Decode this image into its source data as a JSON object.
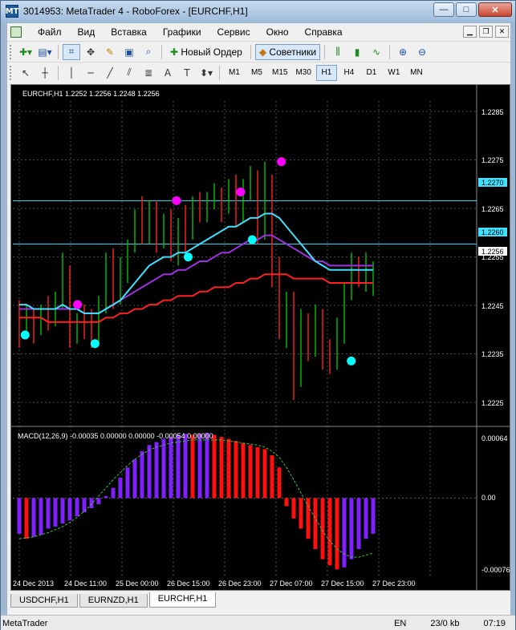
{
  "window": {
    "title": "3014953: MetaTrader 4 - RoboForex - [EURCHF,H1]",
    "app_icon": "MT",
    "buttons": {
      "minimize": "—",
      "maximize": "□",
      "close": "✕"
    }
  },
  "menu": {
    "items": [
      "Файл",
      "Вид",
      "Вставка",
      "Графики",
      "Сервис",
      "Окно",
      "Справка"
    ]
  },
  "toolbar1": {
    "new_order": "Новый Ордер",
    "advisors": "Советники"
  },
  "toolbar2": {
    "timeframes": [
      "M1",
      "M5",
      "M15",
      "M30",
      "H1",
      "H4",
      "D1",
      "W1",
      "MN"
    ],
    "active_timeframe": "H1"
  },
  "chart": {
    "header": "EURCHF,H1  1.2252 1.2256 1.2248 1.2256",
    "price_labels": [
      "1.2285",
      "1.2275",
      "1.2265",
      "1.2255",
      "1.2245",
      "1.2235",
      "1.2225"
    ],
    "hline_labels": [
      "1.2270",
      "1.2260"
    ],
    "current_price": "1.2256",
    "macd_header": "MACD(12,26,9) -0.00035 0.00000 0.00000 -0.00054 0.00000",
    "macd_labels": [
      "0.00064",
      "0.00",
      "-0.00076"
    ],
    "time_labels": [
      "24 Dec 2013",
      "24 Dec 11:00",
      "25 Dec 00:00",
      "26 Dec 15:00",
      "26 Dec 23:00",
      "27 Dec 07:00",
      "27 Dec 15:00",
      "27 Dec 23:00"
    ],
    "colors": {
      "bull": "#00c000",
      "bear": "#ff2020",
      "ma_cyan": "#40e0ff",
      "ma_purple": "#a030e0",
      "ma_red": "#ff2020",
      "macd_pos": "#8020ff",
      "macd_neg": "#ff1010",
      "signal": "#40c040",
      "dot_magenta": "#ff00ff",
      "dot_cyan": "#00ffff"
    }
  },
  "chart_data": {
    "type": "candlestick",
    "price_range": [
      1.2219,
      1.2293
    ],
    "candles": [
      [
        1.2244,
        1.2247,
        1.2236,
        1.2241
      ],
      [
        1.2241,
        1.2246,
        1.2238,
        1.2243
      ],
      [
        1.2243,
        1.2245,
        1.2237,
        1.224
      ],
      [
        1.224,
        1.2246,
        1.2239,
        1.2245
      ],
      [
        1.2245,
        1.2248,
        1.224,
        1.2242
      ],
      [
        1.2242,
        1.2249,
        1.2241,
        1.2248
      ],
      [
        1.2248,
        1.2258,
        1.2245,
        1.2253
      ],
      [
        1.2253,
        1.2255,
        1.2236,
        1.224
      ],
      [
        1.224,
        1.2244,
        1.2237,
        1.2243
      ],
      [
        1.2243,
        1.2246,
        1.2238,
        1.2241
      ],
      [
        1.2241,
        1.2245,
        1.2236,
        1.2238
      ],
      [
        1.2238,
        1.2248,
        1.2237,
        1.2246
      ],
      [
        1.2246,
        1.2258,
        1.2244,
        1.2256
      ],
      [
        1.2256,
        1.2259,
        1.2245,
        1.2248
      ],
      [
        1.2248,
        1.2257,
        1.2246,
        1.2255
      ],
      [
        1.2255,
        1.2261,
        1.2251,
        1.2259
      ],
      [
        1.2259,
        1.2268,
        1.2258,
        1.2266
      ],
      [
        1.2266,
        1.2271,
        1.226,
        1.2262
      ],
      [
        1.2262,
        1.227,
        1.226,
        1.2268
      ],
      [
        1.2268,
        1.227,
        1.2258,
        1.226
      ],
      [
        1.226,
        1.2267,
        1.2259,
        1.2265
      ],
      [
        1.2265,
        1.2268,
        1.2256,
        1.2258
      ],
      [
        1.2258,
        1.2266,
        1.2255,
        1.2264
      ],
      [
        1.2264,
        1.2269,
        1.2258,
        1.2262
      ],
      [
        1.2262,
        1.2271,
        1.2261,
        1.227
      ],
      [
        1.227,
        1.2272,
        1.2265,
        1.2268
      ],
      [
        1.2268,
        1.2272,
        1.2265,
        1.227
      ],
      [
        1.227,
        1.2274,
        1.2268,
        1.2272
      ],
      [
        1.2272,
        1.2273,
        1.2265,
        1.2268
      ],
      [
        1.2268,
        1.2275,
        1.2267,
        1.2273
      ],
      [
        1.2273,
        1.2276,
        1.2264,
        1.2266
      ],
      [
        1.2266,
        1.2275,
        1.2265,
        1.2274
      ],
      [
        1.2274,
        1.2278,
        1.227,
        1.2276
      ],
      [
        1.2276,
        1.2277,
        1.226,
        1.2262
      ],
      [
        1.2262,
        1.2279,
        1.2261,
        1.2275
      ],
      [
        1.2275,
        1.2276,
        1.225,
        1.2253
      ],
      [
        1.2253,
        1.2257,
        1.2238,
        1.2241
      ],
      [
        1.2241,
        1.2249,
        1.2236,
        1.2247
      ],
      [
        1.2247,
        1.2249,
        1.2224,
        1.2228
      ],
      [
        1.2228,
        1.2245,
        1.2227,
        1.224
      ],
      [
        1.224,
        1.2244,
        1.2233,
        1.2236
      ],
      [
        1.2236,
        1.2246,
        1.2234,
        1.2242
      ],
      [
        1.2242,
        1.2245,
        1.2231,
        1.2234
      ],
      [
        1.2234,
        1.2238,
        1.223,
        1.2232
      ],
      [
        1.2232,
        1.2243,
        1.2231,
        1.2238
      ],
      [
        1.2238,
        1.2251,
        1.2237,
        1.2249
      ],
      [
        1.2249,
        1.2258,
        1.2247,
        1.2255
      ],
      [
        1.2255,
        1.2257,
        1.225,
        1.2252
      ],
      [
        1.2252,
        1.2258,
        1.2249,
        1.2254
      ],
      [
        1.2252,
        1.2256,
        1.2248,
        1.2256
      ]
    ],
    "hlines": [
      1.227,
      1.226
    ],
    "ma_cyan": [
      1.2246,
      1.2246,
      1.2245,
      1.2245,
      1.2245,
      1.2245,
      1.2246,
      1.2245,
      1.2245,
      1.2244,
      1.2244,
      1.2244,
      1.2245,
      1.2246,
      1.2247,
      1.2249,
      1.2251,
      1.2253,
      1.2255,
      1.2256,
      1.2257,
      1.2257,
      1.2258,
      1.2258,
      1.2259,
      1.226,
      1.2261,
      1.2262,
      1.2263,
      1.2264,
      1.2264,
      1.2265,
      1.2266,
      1.2266,
      1.2267,
      1.2267,
      1.2266,
      1.2264,
      1.2262,
      1.226,
      1.2258,
      1.2256,
      1.2255,
      1.2254,
      1.2254,
      1.2254,
      1.2254,
      1.2254,
      1.2254,
      1.2254
    ],
    "ma_purple": [
      1.2245,
      1.2245,
      1.2245,
      1.2245,
      1.2245,
      1.2245,
      1.2245,
      1.2245,
      1.2245,
      1.2244,
      1.2244,
      1.2244,
      1.2245,
      1.2246,
      1.2247,
      1.2248,
      1.2249,
      1.225,
      1.2251,
      1.2252,
      1.2253,
      1.2253,
      1.2254,
      1.2254,
      1.2255,
      1.2256,
      1.2256,
      1.2257,
      1.2258,
      1.2258,
      1.2259,
      1.226,
      1.2261,
      1.2261,
      1.2262,
      1.2262,
      1.2261,
      1.226,
      1.2259,
      1.2258,
      1.2257,
      1.2256,
      1.2256,
      1.2255,
      1.2255,
      1.2255,
      1.2255,
      1.2255,
      1.2255,
      1.2255
    ],
    "ma_red": [
      1.2243,
      1.2243,
      1.2243,
      1.2243,
      1.2242,
      1.2242,
      1.2242,
      1.2242,
      1.2242,
      1.2242,
      1.2242,
      1.2242,
      1.2243,
      1.2243,
      1.2244,
      1.2244,
      1.2245,
      1.2245,
      1.2246,
      1.2246,
      1.2247,
      1.2247,
      1.2248,
      1.2248,
      1.2248,
      1.2249,
      1.2249,
      1.225,
      1.225,
      1.225,
      1.2251,
      1.2251,
      1.2252,
      1.2252,
      1.2253,
      1.2253,
      1.2253,
      1.2253,
      1.2252,
      1.2252,
      1.2252,
      1.2252,
      1.2252,
      1.2251,
      1.2251,
      1.2251,
      1.2251,
      1.2251,
      1.2251,
      1.2251
    ],
    "dots": [
      {
        "i": 1,
        "price": 1.2239,
        "color": "cyan"
      },
      {
        "i": 10,
        "price": 1.2246,
        "color": "magenta"
      },
      {
        "i": 13,
        "price": 1.2237,
        "color": "cyan"
      },
      {
        "i": 27,
        "price": 1.227,
        "color": "magenta"
      },
      {
        "i": 29,
        "price": 1.2257,
        "color": "cyan"
      },
      {
        "i": 38,
        "price": 1.2272,
        "color": "magenta"
      },
      {
        "i": 40,
        "price": 1.2261,
        "color": "cyan"
      },
      {
        "i": 45,
        "price": 1.2279,
        "color": "magenta"
      },
      {
        "i": 57,
        "price": 1.2233,
        "color": "cyan"
      }
    ],
    "macd": {
      "range": [
        -0.00076,
        0.00064
      ],
      "hist": [
        -0.00035,
        -0.0004,
        -0.00038,
        -0.00036,
        -0.0003,
        -0.00028,
        -0.00025,
        -0.00022,
        -0.00018,
        -0.00014,
        -0.0001,
        -6e-05,
        2e-05,
        0.0001,
        0.0002,
        0.0003,
        0.00038,
        0.00046,
        0.00052,
        0.00055,
        0.00058,
        0.0006,
        0.00062,
        0.00063,
        0.00062,
        0.00063,
        0.00064,
        0.00062,
        0.0006,
        0.00058,
        0.00056,
        0.00054,
        0.00052,
        0.0005,
        0.00048,
        0.00042,
        0.0003,
        -8e-05,
        -0.0002,
        -0.0003,
        -0.0004,
        -0.0005,
        -0.0006,
        -0.00066,
        -0.0007,
        -0.00068,
        -0.0006,
        -0.0005,
        -0.0004,
        -0.00035
      ],
      "signal": [
        -0.0004,
        -0.00039,
        -0.00038,
        -0.00036,
        -0.00034,
        -0.00031,
        -0.00028,
        -0.00024,
        -0.00019,
        -0.00013,
        -6e-05,
        2e-05,
        0.0001,
        0.00018,
        0.00025,
        0.00032,
        0.00038,
        0.00043,
        0.00047,
        0.0005,
        0.00052,
        0.00054,
        0.00055,
        0.00056,
        0.00057,
        0.00057,
        0.00057,
        0.00057,
        0.00057,
        0.00056,
        0.00055,
        0.00054,
        0.00053,
        0.00052,
        0.0005,
        0.00046,
        0.0004,
        0.0003,
        0.00018,
        5e-05,
        -8e-05,
        -0.0002,
        -0.00032,
        -0.00042,
        -0.0005,
        -0.00055,
        -0.00058,
        -0.00058,
        -0.00056,
        -0.00054
      ]
    }
  },
  "tabs": [
    {
      "label": "USDCHF,H1",
      "active": false
    },
    {
      "label": "EURNZD,H1",
      "active": false
    },
    {
      "label": "EURCHF,H1",
      "active": true
    }
  ],
  "status": {
    "left": "MetaTrader",
    "lang": "EN",
    "traffic": "23/0 kb",
    "time": "07:19"
  }
}
